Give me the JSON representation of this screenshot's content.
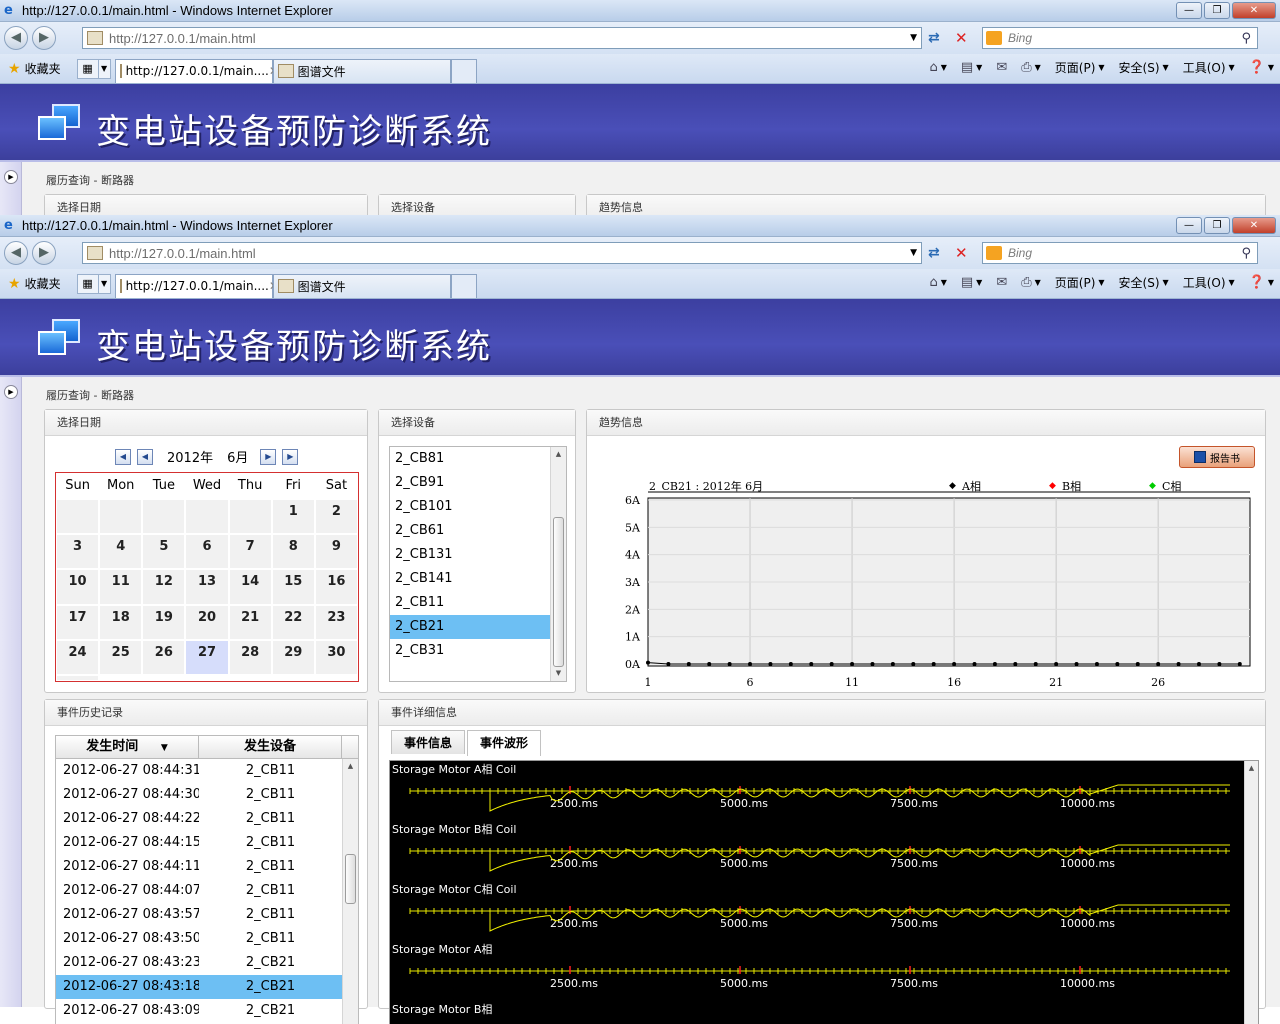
{
  "browser": {
    "window_title": "http://127.0.0.1/main.html - Windows Internet Explorer",
    "url": "http://127.0.0.1/main.html",
    "search_placeholder": "Bing",
    "favorites_label": "收藏夹",
    "tabs": [
      {
        "label": "http://127.0.0.1/main...."
      },
      {
        "label": "图谱文件"
      }
    ],
    "commands": {
      "page": "页面(P)",
      "safety": "安全(S)",
      "tools": "工具(O)"
    }
  },
  "app": {
    "title": "变电站设备预防诊断系统",
    "breadcrumb": "履历查询 - 断路器"
  },
  "calendar": {
    "panel_title": "选择日期",
    "year": "2012年",
    "month": "6月",
    "weekdays": [
      "Sun",
      "Mon",
      "Tue",
      "Wed",
      "Thu",
      "Fri",
      "Sat"
    ],
    "days": [
      "",
      "",
      "",
      "",
      "",
      "1",
      "2",
      "3",
      "4",
      "5",
      "6",
      "7",
      "8",
      "9",
      "10",
      "11",
      "12",
      "13",
      "14",
      "15",
      "16",
      "17",
      "18",
      "19",
      "20",
      "21",
      "22",
      "23",
      "24",
      "25",
      "26",
      "27",
      "28",
      "29",
      "30",
      ""
    ],
    "selected_day": "27"
  },
  "devices": {
    "panel_title": "选择设备",
    "items": [
      "2_CB81",
      "2_CB91",
      "2_CB101",
      "2_CB61",
      "2_CB131",
      "2_CB141",
      "2_CB11",
      "2_CB21",
      "2_CB31"
    ],
    "selected": "2_CB21"
  },
  "trend": {
    "panel_title": "趋势信息",
    "report_button": "报告书"
  },
  "chart_data": {
    "type": "line",
    "title": "2_CB21 : 2012年 6月",
    "x": [
      1,
      2,
      3,
      4,
      5,
      6,
      7,
      8,
      9,
      10,
      11,
      12,
      13,
      14,
      15,
      16,
      17,
      18,
      19,
      20,
      21,
      22,
      23,
      24,
      25,
      26,
      27,
      28,
      29,
      30
    ],
    "xticks": [
      "1",
      "6",
      "11",
      "16",
      "21",
      "26"
    ],
    "yticks": [
      "0A",
      "1A",
      "2A",
      "3A",
      "4A",
      "5A",
      "6A"
    ],
    "ylim": [
      0,
      6
    ],
    "series": [
      {
        "name": "A相",
        "color": "#000000",
        "values": [
          0.05,
          0,
          0,
          0,
          0,
          0,
          0,
          0,
          0,
          0,
          0,
          0,
          0,
          0,
          0,
          0,
          0,
          0,
          0,
          0,
          0,
          0,
          0,
          0,
          0,
          0,
          0,
          0,
          0,
          0
        ]
      },
      {
        "name": "B相",
        "color": "#ff0000",
        "values": []
      },
      {
        "name": "C相",
        "color": "#00cc00",
        "values": []
      }
    ],
    "legend": "top-right",
    "grid": true
  },
  "history": {
    "panel_title": "事件历史记录",
    "col_time": "发生时间",
    "col_device": "发生设备",
    "rows": [
      {
        "time": "2012-06-27 08:44:31",
        "device": "2_CB11"
      },
      {
        "time": "2012-06-27 08:44:30",
        "device": "2_CB11"
      },
      {
        "time": "2012-06-27 08:44:22",
        "device": "2_CB11"
      },
      {
        "time": "2012-06-27 08:44:15",
        "device": "2_CB11"
      },
      {
        "time": "2012-06-27 08:44:11",
        "device": "2_CB11"
      },
      {
        "time": "2012-06-27 08:44:07",
        "device": "2_CB11"
      },
      {
        "time": "2012-06-27 08:43:57",
        "device": "2_CB11"
      },
      {
        "time": "2012-06-27 08:43:50",
        "device": "2_CB11"
      },
      {
        "time": "2012-06-27 08:43:23",
        "device": "2_CB21"
      },
      {
        "time": "2012-06-27 08:43:18",
        "device": "2_CB21"
      },
      {
        "time": "2012-06-27 08:43:09",
        "device": "2_CB21"
      }
    ],
    "selected_index": 9
  },
  "event_detail": {
    "panel_title": "事件详细信息",
    "tab_info": "事件信息",
    "tab_wave": "事件波形",
    "wave_labels": [
      "Storage Motor A相 Coil",
      "Storage Motor B相 Coil",
      "Storage Motor C相 Coil",
      "Storage Motor A相",
      "Storage Motor B相"
    ],
    "time_marks": [
      "2500.ms",
      "5000.ms",
      "7500.ms",
      "10000.ms"
    ]
  }
}
